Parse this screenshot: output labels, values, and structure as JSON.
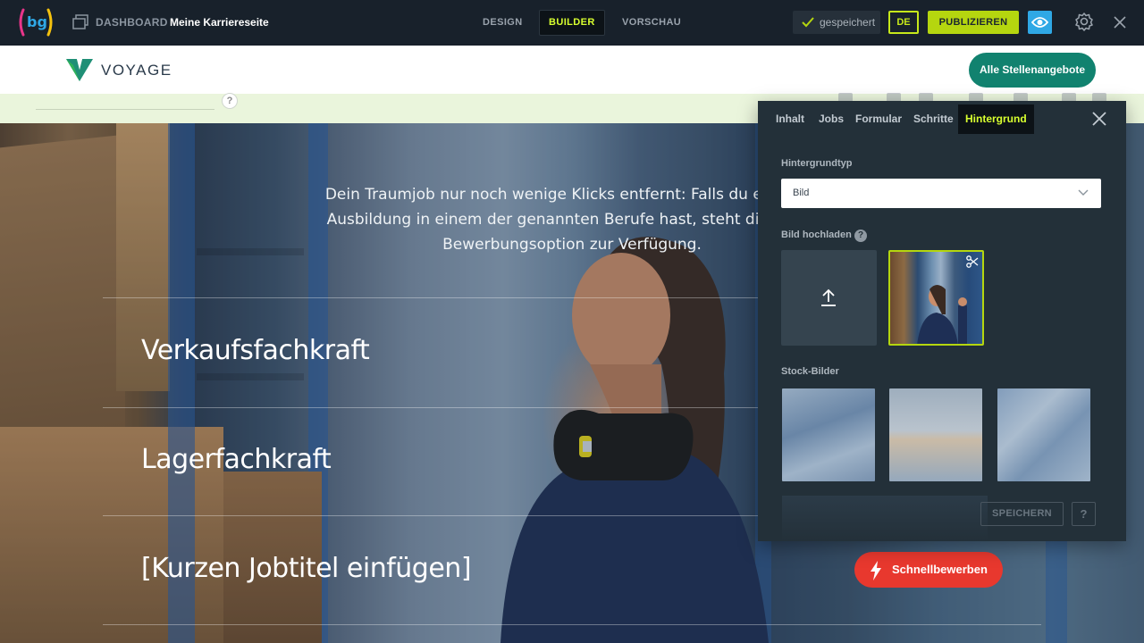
{
  "topbar": {
    "logo_text": "bg",
    "dashboard_label": "DASHBOARD",
    "page_name": "Meine Karriereseite",
    "modes": [
      {
        "label": "DESIGN",
        "active": false
      },
      {
        "label": "BUILDER",
        "active": true
      },
      {
        "label": "VORSCHAU",
        "active": false
      }
    ],
    "saved_label": "gespeichert",
    "language": "DE",
    "publish_label": "PUBLIZIEREN",
    "accent_color": "#b5d60f",
    "preview_color": "#2fa8e5"
  },
  "site_header": {
    "brand_name": "VOYAGE",
    "jobs_button": "Alle Stellenangebote",
    "jobs_button_color": "#11826f"
  },
  "strip": {
    "help": "?"
  },
  "hero": {
    "intro_lines": [
      "Dein Traumjob nur noch wenige Klicks entfernt: Falls du eine abg",
      "Ausbildung in einem der genannten Berufe hast, steht dir eine u",
      "Bewerbungsoption zur Verfügung."
    ],
    "jobs": [
      {
        "title": "Verkaufsfachkraft"
      },
      {
        "title": "Lagerfachkraft"
      },
      {
        "title": "[Kurzen Jobtitel einfügen]"
      }
    ],
    "quick_apply_label": "Schnellbewerben",
    "quick_apply_color": "#e8382e"
  },
  "panel": {
    "tabs": [
      {
        "label": "Inhalt",
        "active": false
      },
      {
        "label": "Jobs",
        "active": false
      },
      {
        "label": "Formular",
        "active": false
      },
      {
        "label": "Schritte",
        "active": false
      },
      {
        "label": "Hintergrund",
        "active": true
      }
    ],
    "background_type_label": "Hintergrundtyp",
    "background_type_value": "Bild",
    "upload_label": "Bild hochladen",
    "help": "?",
    "stock_label": "Stock-Bilder",
    "save_label": "SPEICHERN",
    "help_button": "?"
  }
}
